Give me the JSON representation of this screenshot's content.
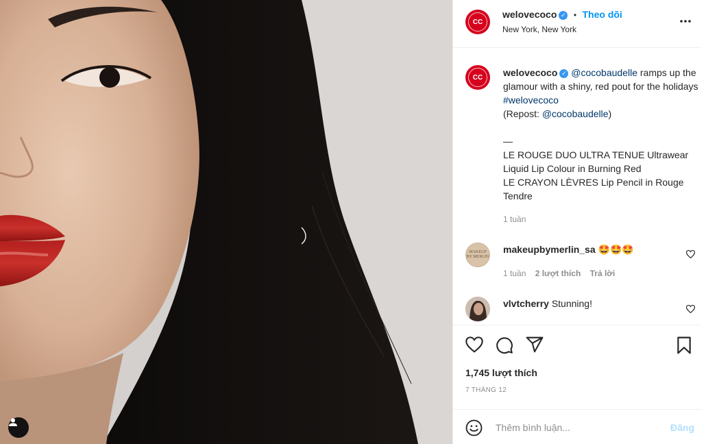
{
  "post": {
    "image_alt": "Close-up portrait with red lipstick",
    "user_tag_icon": "user-icon"
  },
  "header": {
    "username": "welovecoco",
    "separator": "•",
    "follow_label": "Theo dõi",
    "location": "New York, New York",
    "more_icon": "more-horizontal-icon",
    "avatar_text": "CC"
  },
  "caption": {
    "username": "welovecoco",
    "mention": "@cocobaudelle",
    "text_1": " ramps up the glamour with a shiny, red pout for the holidays ",
    "hashtag": "#welovecoco",
    "repost_prefix": "(Repost: ",
    "repost_mention": "@cocobaudelle",
    "repost_suffix": ")",
    "dash": "—",
    "line_1": "LE ROUGE DUO ULTRA TENUE Ultrawear Liquid Lip Colour in Burning Red",
    "line_2": "LE CRAYON LÈVRES Lip Pencil in Rouge Tendre",
    "time": "1 tuần"
  },
  "comments": [
    {
      "username": "makeupbymerlin_sa",
      "text": "🤩🤩🤩",
      "time": "1 tuần",
      "likes": "2 lượt thích",
      "reply": "Trả lời"
    },
    {
      "username": "vlvtcherry",
      "text": "Stunning!"
    }
  ],
  "actions": {
    "like_icon": "heart-icon",
    "comment_icon": "comment-icon",
    "share_icon": "share-icon",
    "save_icon": "bookmark-icon",
    "likes": "1,745 lượt thích",
    "date": "7 THÁNG 12"
  },
  "add_comment": {
    "emoji_icon": "smiley-icon",
    "placeholder": "Thêm bình luận...",
    "post_label": "Đăng"
  },
  "colors": {
    "accent": "#0095f6",
    "brand_red": "#d6001c",
    "verified": "#3897f0"
  }
}
